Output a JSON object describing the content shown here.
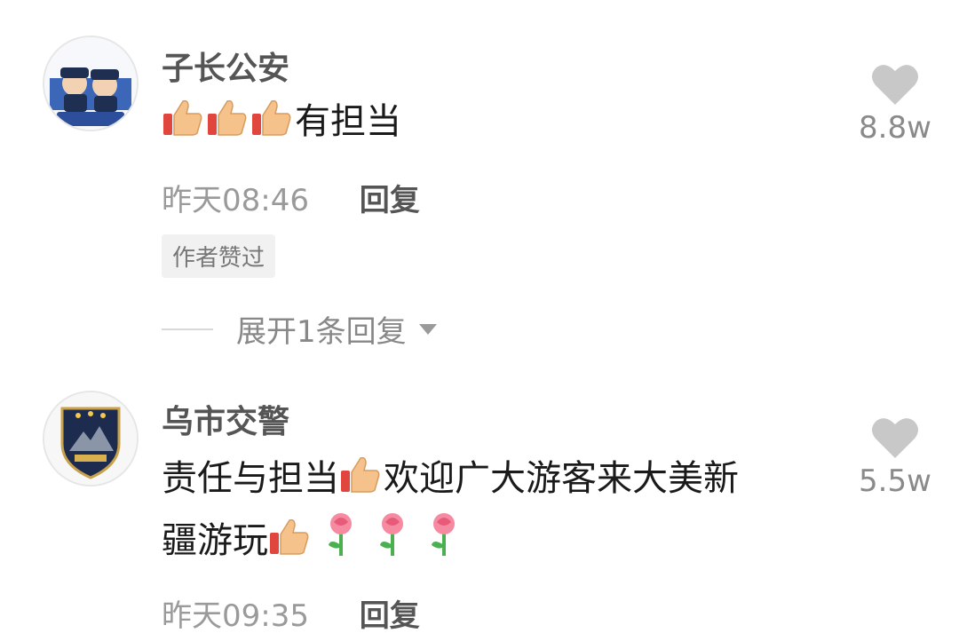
{
  "comments": [
    {
      "author": "子长公安",
      "avatar_icon": "police-avatar-icon",
      "text_emojis": [
        "thumbs-up-icon",
        "thumbs-up-icon",
        "thumbs-up-icon"
      ],
      "text": "有担当",
      "time": "昨天08:46",
      "reply_label": "回复",
      "badge": "作者赞过",
      "expand_label": "展开1条回复",
      "likes": "8.8w"
    },
    {
      "author": "乌市交警",
      "avatar_icon": "traffic-police-badge-icon",
      "text_part1": "责任与担当",
      "text_part2": "欢迎广大游客来大美新",
      "text_part3": "疆游玩",
      "time": "昨天09:35",
      "reply_label": "回复",
      "likes": "5.5w"
    }
  ],
  "colors": {
    "heart": "#c8c8c8",
    "muted": "#9a9a9a",
    "author": "#555555"
  }
}
